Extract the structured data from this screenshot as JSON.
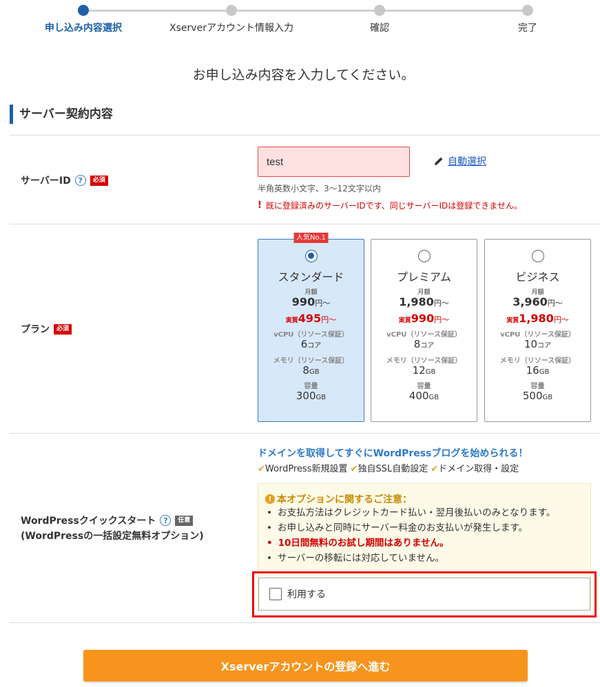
{
  "stepper": {
    "steps": [
      {
        "label": "申し込み内容選択",
        "active": true
      },
      {
        "label": "Xserverアカウント情報入力",
        "active": false
      },
      {
        "label": "確認",
        "active": false
      },
      {
        "label": "完了",
        "active": false
      }
    ]
  },
  "page_title": "お申し込み内容を入力してください。",
  "section_heading": "サーバー契約内容",
  "server_id": {
    "label": "サーバーID",
    "required_badge": "必須",
    "help": "?",
    "value": "test",
    "auto_select": "自動選択",
    "hint": "半角英数小文字、3～12文字以内",
    "error": "既に登録済みのサーバーIDです、同じサーバーIDは登録できません。",
    "error_icon": "!"
  },
  "plan": {
    "label": "プラン",
    "required_badge": "必須",
    "monthly_label": "月額",
    "effective_label": "実質",
    "yen": "円～",
    "vcpu_label": "vCPU（リソース保証）",
    "memory_label": "メモリ（リソース保証）",
    "storage_label": "容量",
    "core_unit": "コア",
    "gb_unit": "GB",
    "options": [
      {
        "name": "スタンダード",
        "tag": "人気No.1",
        "price": "990",
        "effective": "495",
        "vcpu": "6",
        "memory": "8",
        "storage": "300",
        "selected": true
      },
      {
        "name": "プレミアム",
        "tag": "",
        "price": "1,980",
        "effective": "990",
        "vcpu": "8",
        "memory": "12",
        "storage": "400",
        "selected": false
      },
      {
        "name": "ビジネス",
        "tag": "",
        "price": "3,960",
        "effective": "1,980",
        "vcpu": "10",
        "memory": "16",
        "storage": "500",
        "selected": false
      }
    ]
  },
  "wordpress": {
    "label": "WordPressクイックスタート",
    "sublabel": "(WordPressの一括設定無料オプション)",
    "optional_badge": "任意",
    "help": "?",
    "lead": "ドメインを取得してすぐにWordPressブログを始められる！",
    "features": [
      "WordPress新規設置",
      "独自SSL自動設定",
      "ドメイン取得・設定"
    ],
    "notice_title": "本オプションに関するご注意：",
    "notice_icon": "!",
    "notices": [
      {
        "text": "お支払方法はクレジットカード払い・翌月後払いのみとなります。",
        "emphasis": false
      },
      {
        "text": "お申し込みと同時にサーバー料金のお支払いが発生します。",
        "emphasis": false
      },
      {
        "text": "10日間無料のお試し期間はありません。",
        "emphasis": true
      },
      {
        "text": "サーバーの移転には対応していません。",
        "emphasis": false
      }
    ],
    "use_label": "利用する",
    "use_checked": false
  },
  "submit_label": "Xserverアカウントの登録へ進む",
  "colors": {
    "accent": "#1e5fa8",
    "error": "#d40000",
    "submit": "#f7941d"
  }
}
